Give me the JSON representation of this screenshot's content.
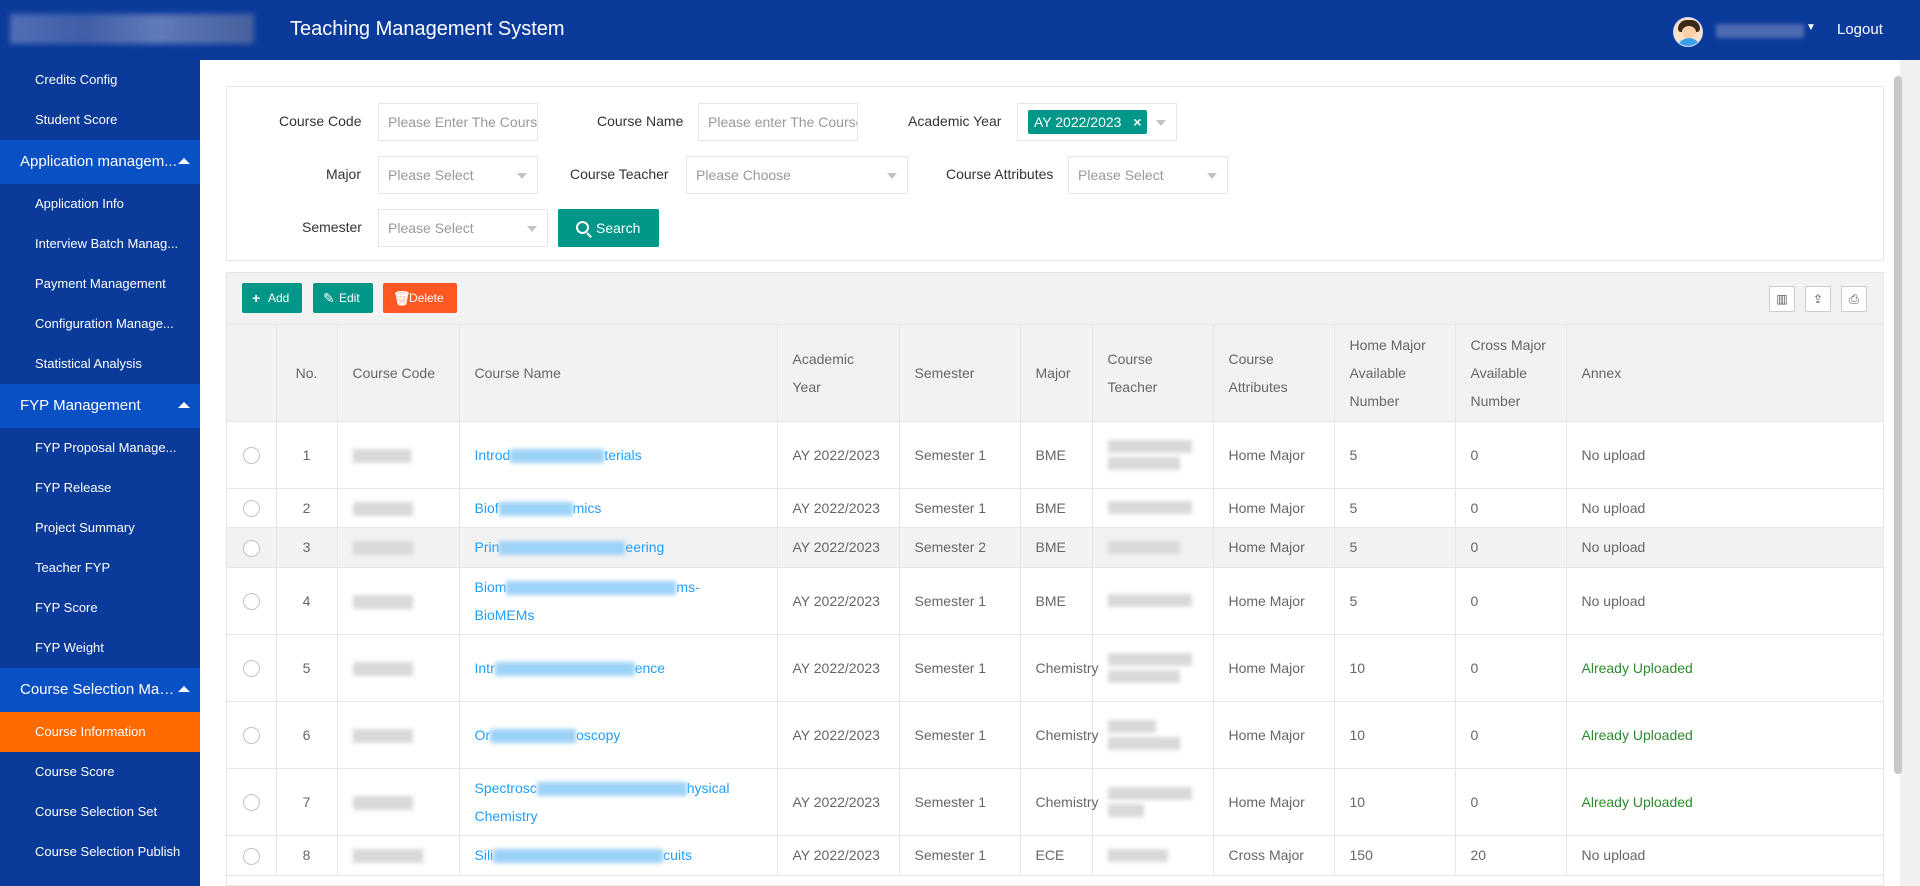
{
  "header": {
    "title": "Teaching Management System",
    "logout": "Logout"
  },
  "sidebar": {
    "items_top": [
      "Credits Config",
      "Student Score"
    ],
    "group_app": "Application managem...",
    "items_app": [
      "Application Info",
      "Interview Batch Manag...",
      "Payment Management",
      "Configuration Manage...",
      "Statistical Analysis"
    ],
    "group_fyp": "FYP Management",
    "items_fyp": [
      "FYP Proposal Manage...",
      "FYP Release",
      "Project Summary",
      "Teacher FYP",
      "FYP Score",
      "FYP Weight"
    ],
    "group_course": "Course Selection Man...",
    "items_course": [
      "Course Information",
      "Course Score",
      "Course Selection Set",
      "Course Selection Publish"
    ]
  },
  "filters": {
    "course_code_label": "Course Code",
    "course_code_placeholder": "Please Enter The Course Code",
    "course_name_label": "Course Name",
    "course_name_placeholder": "Please enter The Course Name",
    "academic_year_label": "Academic Year",
    "academic_year_chip": "AY 2022/2023",
    "major_label": "Major",
    "major_placeholder": "Please Select",
    "teacher_label": "Course Teacher",
    "teacher_placeholder": "Please Choose",
    "attributes_label": "Course Attributes",
    "attributes_placeholder": "Please Select",
    "semester_label": "Semester",
    "semester_placeholder": "Please Select",
    "search": "Search"
  },
  "toolbar": {
    "add": "Add",
    "edit": "Edit",
    "delete": "Delete"
  },
  "colors": {
    "header": "#0a3a9a",
    "active": "#ff6a00",
    "primary": "#009688",
    "danger": "#ff5722",
    "link": "#1e9fff"
  },
  "table": {
    "headers": {
      "no": "No.",
      "code": "Course Code",
      "name": "Course Name",
      "year_1": "Academic",
      "year_2": "Year",
      "semester": "Semester",
      "major": "Major",
      "teacher_1": "Course",
      "teacher_2": "Teacher",
      "attr_1": "Course",
      "attr_2": "Attributes",
      "home_1": "Home Major",
      "home_2": "Available",
      "home_3": "Number",
      "cross_1": "Cross Major",
      "cross_2": "Available",
      "cross_3": "Number",
      "annex": "Annex"
    },
    "rows": [
      {
        "no": "1",
        "name_a": "Introd",
        "name_b": "terials",
        "name_c": "",
        "year": "AY 2022/2023",
        "semester": "Semester 1",
        "major": "BME",
        "attr": "Home Major",
        "home": "5",
        "cross": "0",
        "annex": "No upload"
      },
      {
        "no": "2",
        "name_a": "Biof",
        "name_b": "mics",
        "name_c": "",
        "year": "AY 2022/2023",
        "semester": "Semester 1",
        "major": "BME",
        "attr": "Home Major",
        "home": "5",
        "cross": "0",
        "annex": "No upload"
      },
      {
        "no": "3",
        "name_a": "Prin",
        "name_b": "eering",
        "name_c": "",
        "year": "AY 2022/2023",
        "semester": "Semester 2",
        "major": "BME",
        "attr": "Home Major",
        "home": "5",
        "cross": "0",
        "annex": "No upload"
      },
      {
        "no": "4",
        "name_a": "Biom",
        "name_b": "ms-",
        "name_c": "BioMEMs",
        "year": "AY 2022/2023",
        "semester": "Semester 1",
        "major": "BME",
        "attr": "Home Major",
        "home": "5",
        "cross": "0",
        "annex": "No upload"
      },
      {
        "no": "5",
        "name_a": "Intr",
        "name_b": "ence",
        "name_c": "",
        "year": "AY 2022/2023",
        "semester": "Semester 1",
        "major": "Chemistry",
        "attr": "Home Major",
        "home": "10",
        "cross": "0",
        "annex": "Already Uploaded"
      },
      {
        "no": "6",
        "name_a": "Or",
        "name_b": "oscopy",
        "name_c": "",
        "year": "AY 2022/2023",
        "semester": "Semester 1",
        "major": "Chemistry",
        "attr": "Home Major",
        "home": "10",
        "cross": "0",
        "annex": "Already Uploaded"
      },
      {
        "no": "7",
        "name_a": "Spectrosc",
        "name_b": "hysical",
        "name_c": "Chemistry",
        "year": "AY 2022/2023",
        "semester": "Semester 1",
        "major": "Chemistry",
        "attr": "Home Major",
        "home": "10",
        "cross": "0",
        "annex": "Already Uploaded"
      },
      {
        "no": "8",
        "name_a": "Sili",
        "name_b": "cuits",
        "name_c": "",
        "year": "AY 2022/2023",
        "semester": "Semester 1",
        "major": "ECE",
        "attr": "Cross Major",
        "home": "150",
        "cross": "20",
        "annex": "No upload"
      }
    ]
  }
}
